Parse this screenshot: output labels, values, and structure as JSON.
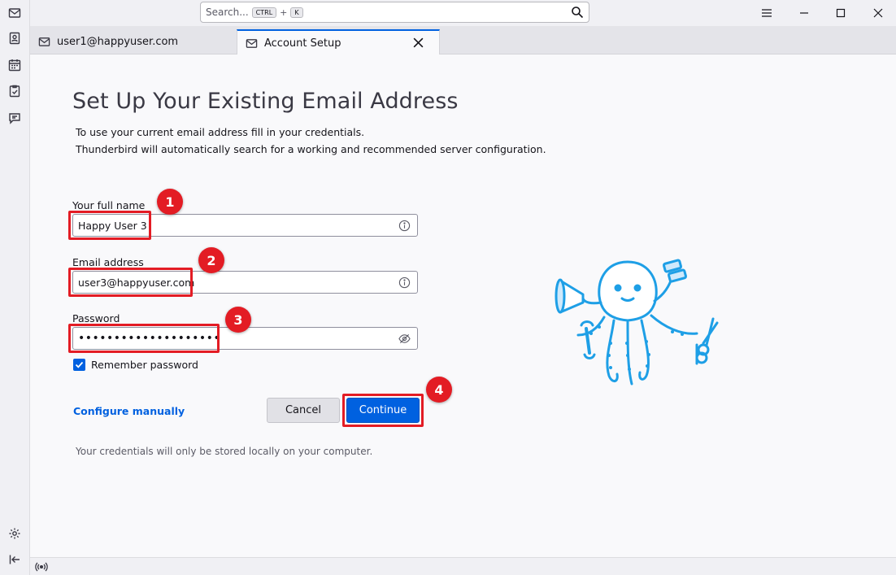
{
  "titlebar": {
    "search_placeholder": "Search...",
    "shortcut_key1": "CTRL",
    "shortcut_plus": "+",
    "shortcut_key2": "K"
  },
  "tabs": [
    {
      "label": "user1@happyuser.com",
      "icon": "mail-icon",
      "active": false
    },
    {
      "label": "Account Setup",
      "icon": "mail-icon",
      "active": true
    }
  ],
  "spaces": [
    "mail-icon",
    "address-book-icon",
    "calendar-icon",
    "tasks-icon",
    "chat-icon",
    "settings-icon",
    "collapse-icon"
  ],
  "setup": {
    "title": "Set Up Your Existing Email Address",
    "desc_line1": "To use your current email address fill in your credentials.",
    "desc_line2": "Thunderbird will automatically search for a working and recommended server configuration.",
    "name_label": "Your full name",
    "name_value": "Happy User 3",
    "email_label": "Email address",
    "email_value": "user3@happyuser.com",
    "password_label": "Password",
    "password_value": "••••••••••••••••••••",
    "remember_label": "Remember password",
    "remember_checked": true,
    "configure_link": "Configure manually",
    "cancel_label": "Cancel",
    "continue_label": "Continue",
    "footnote": "Your credentials will only be stored locally on your computer."
  },
  "annotations": [
    "1",
    "2",
    "3",
    "4"
  ],
  "colors": {
    "accent": "#0061e0",
    "annotation": "#e31c24",
    "mascot": "#1e9fe6"
  }
}
